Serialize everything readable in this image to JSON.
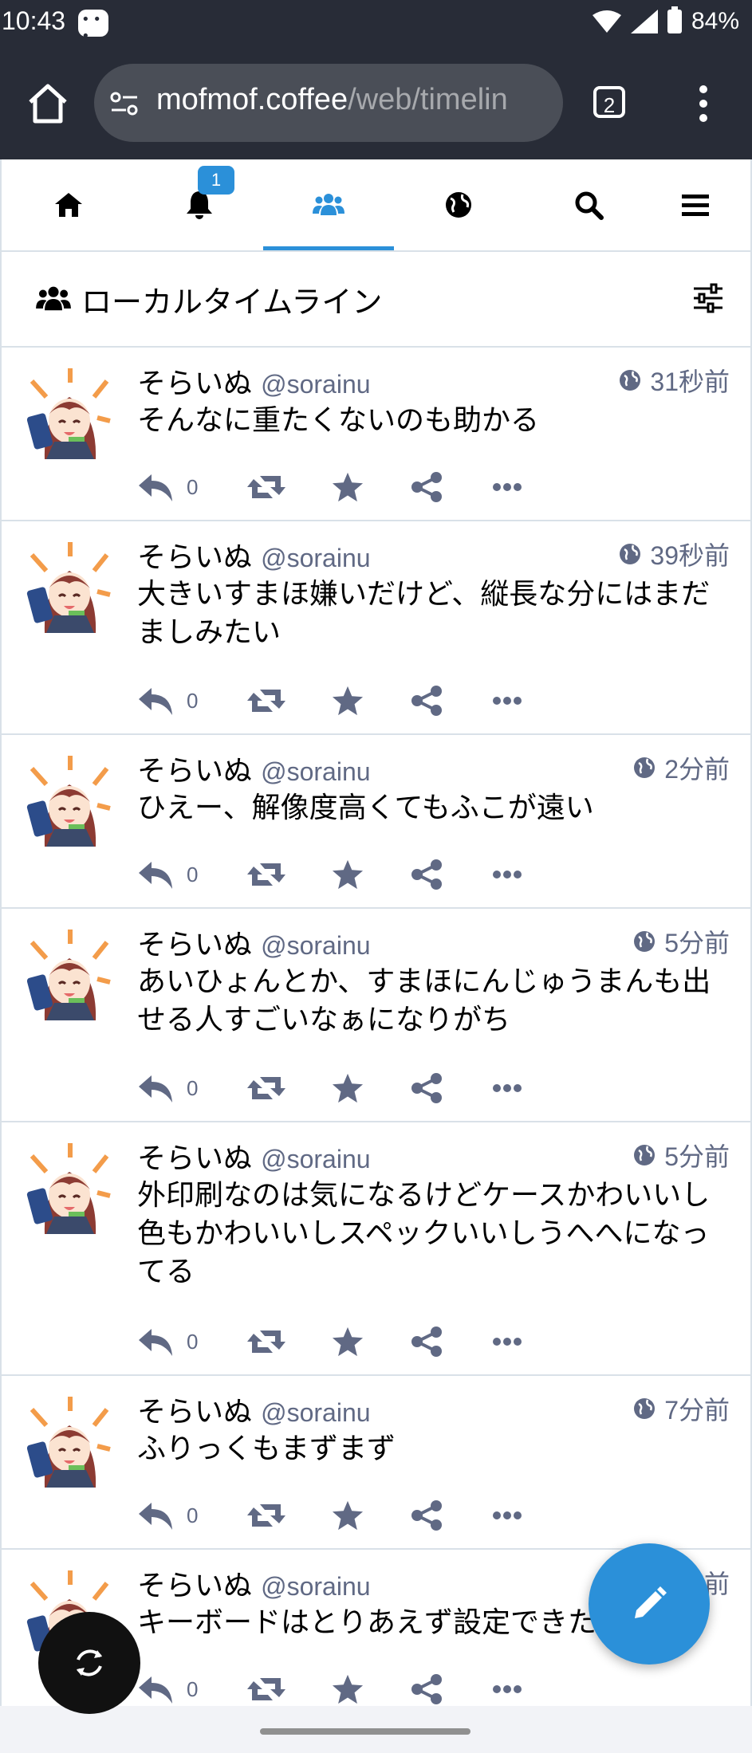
{
  "statusbar": {
    "time": "10:43",
    "battery": "84%"
  },
  "browser": {
    "url_host": "mofmof.coffee",
    "url_path": "/web/timelin",
    "tab_count": "2"
  },
  "nav": {
    "notification_badge": "1"
  },
  "column": {
    "title": "ローカルタイムライン"
  },
  "statuses": [
    {
      "display_name": "そらいぬ",
      "acct": "@sorainu",
      "time": "31秒前",
      "content": "そんなに重たくないのも助かる",
      "replies": "0"
    },
    {
      "display_name": "そらいぬ",
      "acct": "@sorainu",
      "time": "39秒前",
      "content": "大きいすまほ嫌いだけど、縦長な分にはまだましみたい",
      "replies": "0"
    },
    {
      "display_name": "そらいぬ",
      "acct": "@sorainu",
      "time": "2分前",
      "content": "ひえー、解像度高くてもふこが遠い",
      "replies": "0"
    },
    {
      "display_name": "そらいぬ",
      "acct": "@sorainu",
      "time": "5分前",
      "content": "あいひょんとか、すまほにんじゅうまんも出せる人すごいなぁになりがち",
      "replies": "0"
    },
    {
      "display_name": "そらいぬ",
      "acct": "@sorainu",
      "time": "5分前",
      "content": "外印刷なのは気になるけどケースかわいいし色もかわいいしスペックいいしうへへになってる",
      "replies": "0"
    },
    {
      "display_name": "そらいぬ",
      "acct": "@sorainu",
      "time": "7分前",
      "content": "ふりっくもまずまず",
      "replies": "0"
    },
    {
      "display_name": "そらいぬ",
      "acct": "@sorainu",
      "time": "前",
      "content": "キーボードはとりあえず設定できた",
      "replies": "0"
    }
  ],
  "colors": {
    "accent": "#2b90d9",
    "icon": "#606984",
    "dark": "#282c37"
  }
}
